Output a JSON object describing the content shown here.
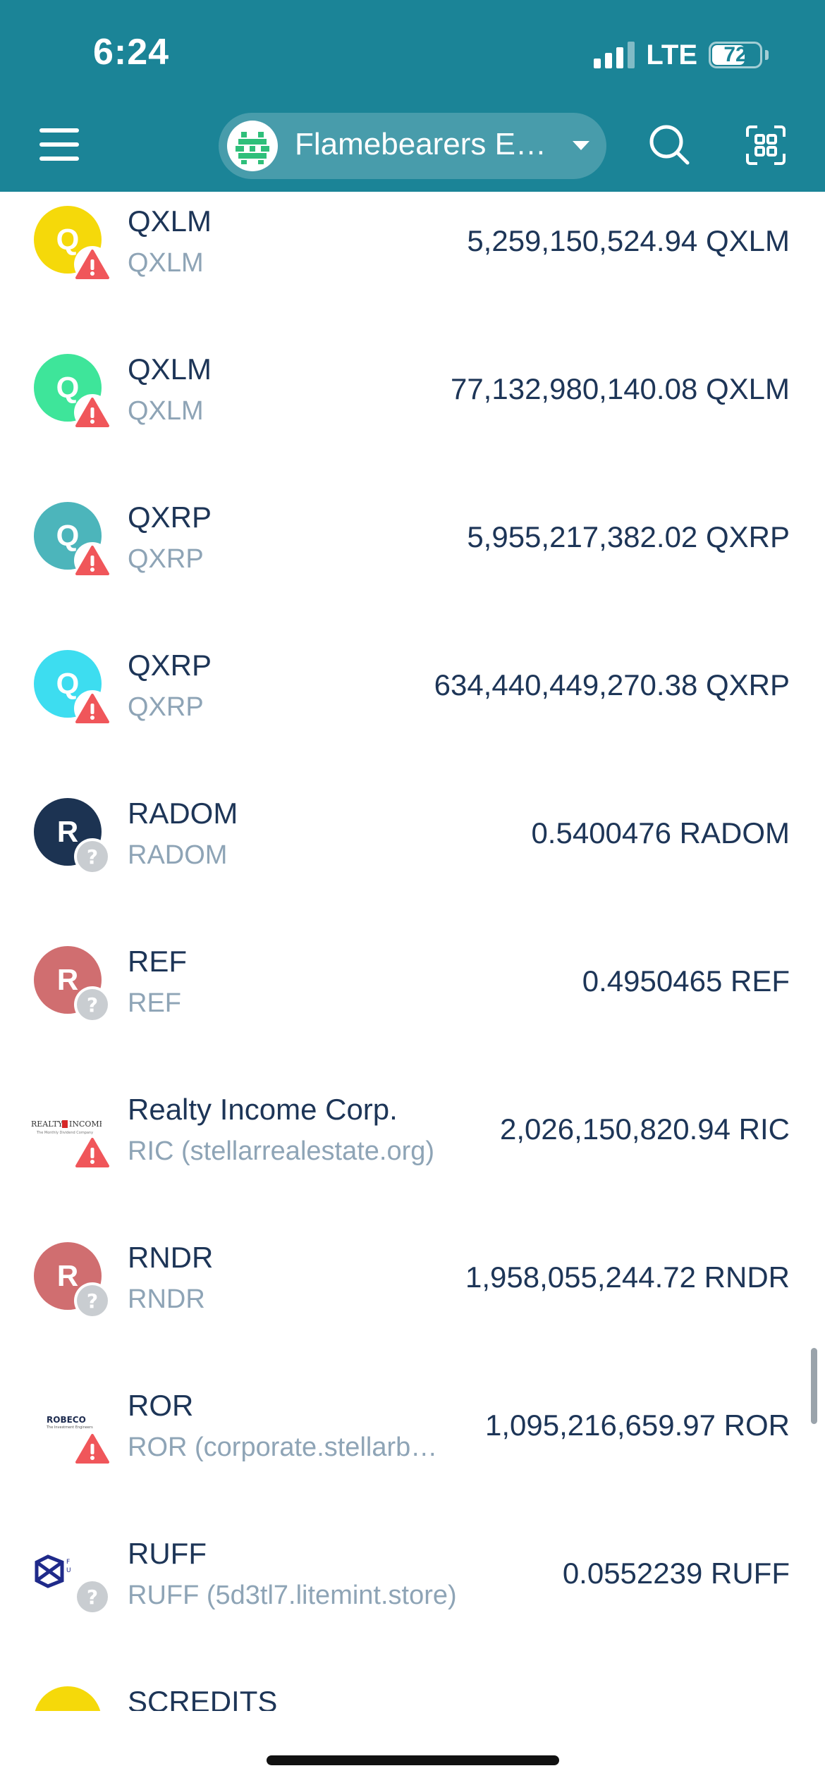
{
  "status_bar": {
    "time": "6:24",
    "network": "LTE",
    "battery": "72"
  },
  "header": {
    "account_name": "Flamebearers E…",
    "icons": {
      "menu": "hamburger-menu-icon",
      "search": "search-icon",
      "scan": "qr-scan-icon",
      "dropdown": "chevron-down-icon"
    }
  },
  "colors": {
    "header": "#1b8497",
    "text_primary": "#1d3557",
    "text_secondary": "#8ea4b6",
    "warning": "#f0565a",
    "unknown_badge": "#c9cdd1"
  },
  "assets": [
    {
      "name": "QXLM",
      "code": "QXLM",
      "balance": "5,259,150,524.94 QXLM",
      "icon_letter": "Q",
      "icon_color": "#f5d90a",
      "badge": "warning"
    },
    {
      "name": "QXLM",
      "code": "QXLM",
      "balance": "77,132,980,140.08 QXLM",
      "icon_letter": "Q",
      "icon_color": "#3ee59a",
      "badge": "warning"
    },
    {
      "name": "QXRP",
      "code": "QXRP",
      "balance": "5,955,217,382.02 QXRP",
      "icon_letter": "Q",
      "icon_color": "#4cb5bb",
      "badge": "warning"
    },
    {
      "name": "QXRP",
      "code": "QXRP",
      "balance": "634,440,449,270.38 QXRP",
      "icon_letter": "Q",
      "icon_color": "#3dddf0",
      "badge": "warning"
    },
    {
      "name": "RADOM",
      "code": "RADOM",
      "balance": "0.5400476 RADOM",
      "icon_letter": "R",
      "icon_color": "#1c3352",
      "badge": "unknown"
    },
    {
      "name": "REF",
      "code": "REF",
      "balance": "0.4950465 REF",
      "icon_letter": "R",
      "icon_color": "#d06e70",
      "badge": "unknown"
    },
    {
      "name": "Realty Income Corp.",
      "code": "RIC (stellarrealestate.org)",
      "balance": "2,026,150,820.94 RIC",
      "icon_logo": "REALTY INCOME",
      "badge": "warning"
    },
    {
      "name": "RNDR",
      "code": "RNDR",
      "balance": "1,958,055,244.72 RNDR",
      "icon_letter": "R",
      "icon_color": "#d06e70",
      "badge": "unknown"
    },
    {
      "name": "ROR",
      "code": "ROR (corporate.stellarb…",
      "balance": "1,095,216,659.97 ROR",
      "icon_logo": "ROBECO",
      "badge": "warning"
    },
    {
      "name": "RUFF",
      "code": "RUFF (5d3tl7.litemint.store)",
      "balance": "0.0552239 RUFF",
      "icon_logo": "RUFF",
      "badge": "unknown"
    },
    {
      "name": "SCREDITS",
      "code": "",
      "balance": "",
      "icon_letter": "",
      "icon_color": "#f5d90a",
      "badge": ""
    }
  ]
}
